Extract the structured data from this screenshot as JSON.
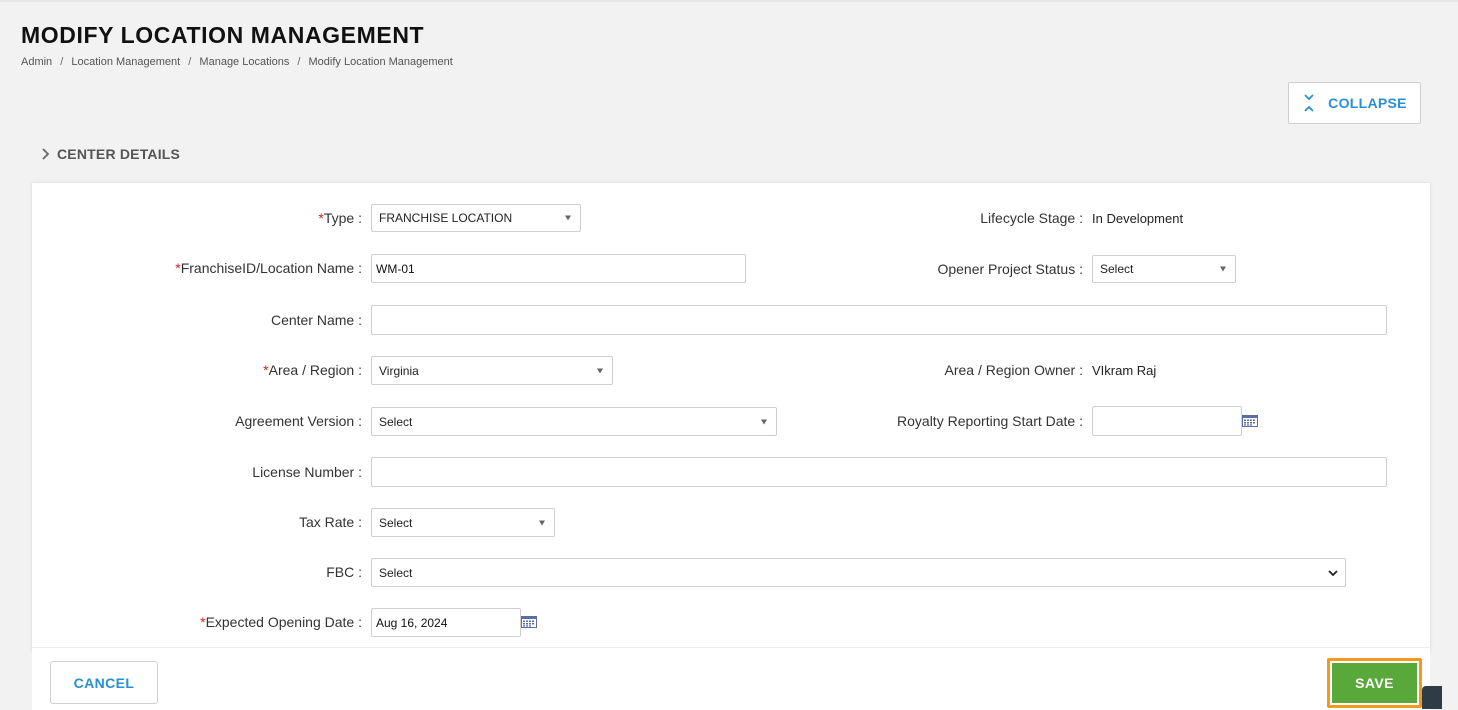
{
  "header": {
    "title": "MODIFY LOCATION MANAGEMENT",
    "breadcrumb": [
      "Admin",
      "Location Management",
      "Manage Locations",
      "Modify Location Management"
    ],
    "breadcrumb_sep": "/"
  },
  "toolbar": {
    "collapse_label": "COLLAPSE"
  },
  "section": {
    "title": "CENTER DETAILS"
  },
  "form": {
    "required_mark": "*",
    "type": {
      "label": "Type :",
      "value": "FRANCHISE LOCATION"
    },
    "lifecycle": {
      "label": "Lifecycle Stage :",
      "value": "In Development"
    },
    "franchise_id": {
      "label": "FranchiseID/Location Name :",
      "value": "WM-01"
    },
    "opener_status": {
      "label": "Opener Project Status :",
      "value": "Select"
    },
    "center_name": {
      "label": "Center Name :",
      "value": ""
    },
    "area_region": {
      "label": "Area / Region :",
      "value": "Virginia"
    },
    "area_owner": {
      "label": "Area / Region Owner :",
      "value": "VIkram Raj"
    },
    "agreement_version": {
      "label": "Agreement Version :",
      "value": "Select"
    },
    "royalty_start": {
      "label": "Royalty Reporting Start Date :",
      "value": ""
    },
    "license_number": {
      "label": "License Number :",
      "value": ""
    },
    "tax_rate": {
      "label": "Tax Rate :",
      "value": "Select"
    },
    "fbc": {
      "label": "FBC :",
      "value": "Select"
    },
    "opening_date": {
      "label": "Expected Opening Date :",
      "value": "Aug 16, 2024"
    }
  },
  "footer": {
    "cancel_label": "CANCEL",
    "save_label": "SAVE"
  },
  "colors": {
    "accent_blue": "#2a8fd6",
    "save_green": "#59a83a",
    "highlight_orange": "#f39a1e",
    "required_red": "#d02020"
  },
  "icons": {
    "collapse": "collapse-icon",
    "section_chevron": "chevron-right-icon",
    "calendar": "calendar-icon",
    "select_caret": "caret-down-icon"
  }
}
